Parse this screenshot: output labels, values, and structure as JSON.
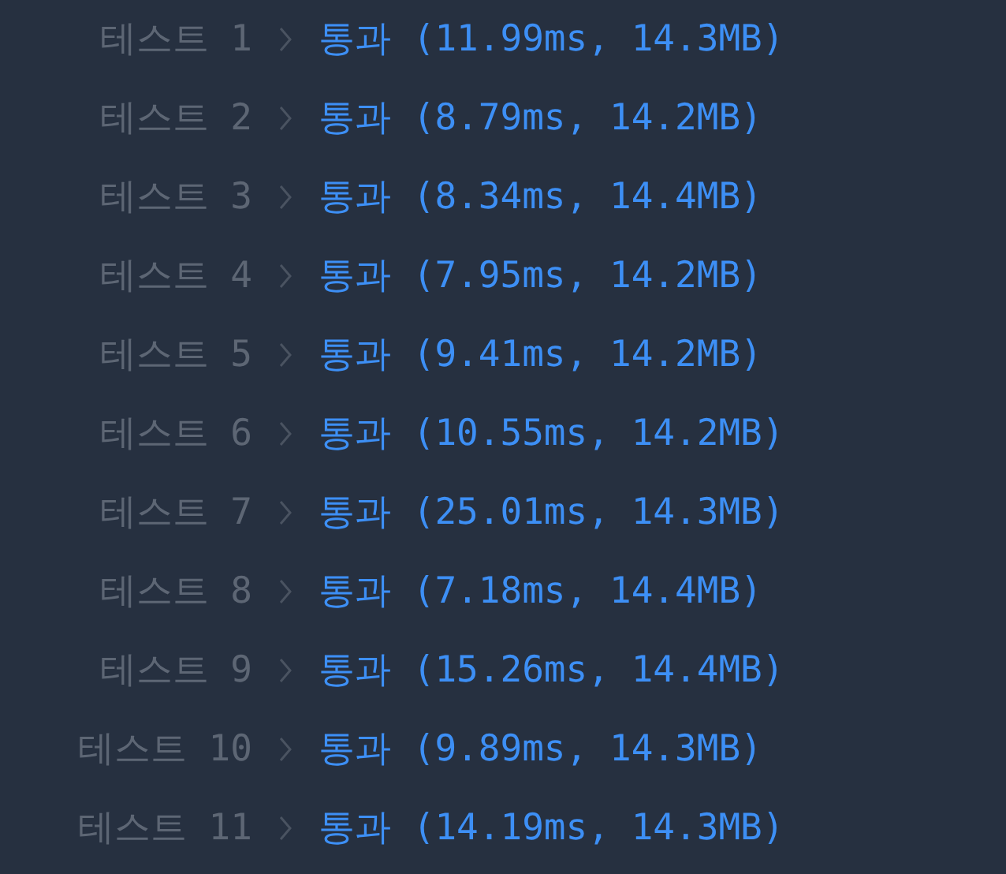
{
  "results": [
    {
      "label": "테스트 1",
      "result": "통과 (11.99ms, 14.3MB)"
    },
    {
      "label": "테스트 2",
      "result": "통과 (8.79ms, 14.2MB)"
    },
    {
      "label": "테스트 3",
      "result": "통과 (8.34ms, 14.4MB)"
    },
    {
      "label": "테스트 4",
      "result": "통과 (7.95ms, 14.2MB)"
    },
    {
      "label": "테스트 5",
      "result": "통과 (9.41ms, 14.2MB)"
    },
    {
      "label": "테스트 6",
      "result": "통과 (10.55ms, 14.2MB)"
    },
    {
      "label": "테스트 7",
      "result": "통과 (25.01ms, 14.3MB)"
    },
    {
      "label": "테스트 8",
      "result": "통과 (7.18ms, 14.4MB)"
    },
    {
      "label": "테스트 9",
      "result": "통과 (15.26ms, 14.4MB)"
    },
    {
      "label": "테스트 10",
      "result": "통과 (9.89ms, 14.3MB)"
    },
    {
      "label": "테스트 11",
      "result": "통과 (14.19ms, 14.3MB)"
    }
  ]
}
